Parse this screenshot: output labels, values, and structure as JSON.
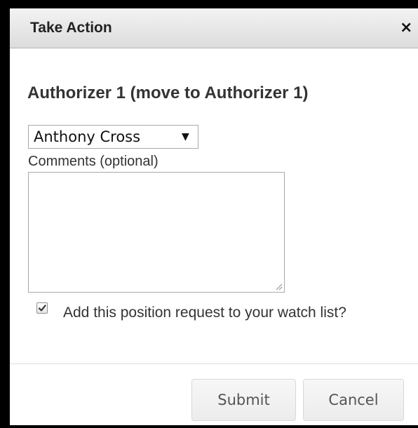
{
  "dialog": {
    "title": "Take Action",
    "close_icon": "×"
  },
  "form": {
    "heading": "Authorizer 1 (move to Authorizer 1)",
    "authorizer_select": {
      "selected": "Anthony Cross",
      "arrow_icon": "▼"
    },
    "comments_label": "Comments (optional)",
    "comments_value": "",
    "watch_checked": true,
    "watch_label": "Add this position request to your watch list?"
  },
  "footer": {
    "submit_label": "Submit",
    "cancel_label": "Cancel"
  }
}
